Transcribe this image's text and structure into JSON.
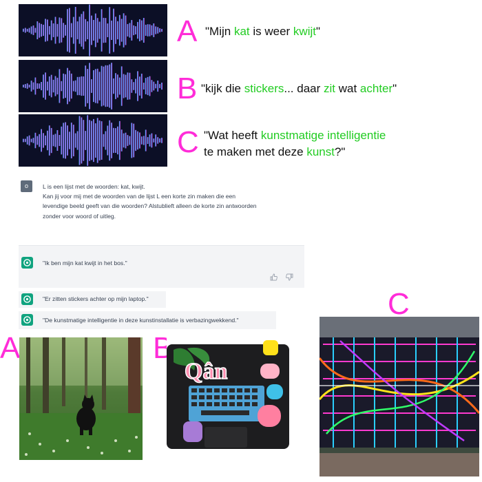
{
  "audio": [
    {
      "letter": "A",
      "parts": [
        "\"Mijn ",
        "kat",
        " is weer ",
        "kwijt",
        "\""
      ]
    },
    {
      "letter": "B",
      "parts": [
        "\"kijk die ",
        "stickers",
        "... daar ",
        "zit",
        " wat ",
        "achter",
        "\""
      ]
    },
    {
      "letter": "C",
      "line1": [
        "\"Wat heeft ",
        "kunstmatige intelligentie"
      ],
      "line2": [
        "te maken met deze ",
        "kunst",
        "?\""
      ]
    }
  ],
  "chat": {
    "user_badge": "o",
    "prompt_lines": [
      "L is een lijst met de woorden: kat, kwijt.",
      "Kan jij voor mij met de woorden van de lijst L een korte zin maken die een",
      "levendige beeld geeft van die woorden? Alstublieft alleen de korte zin antwoorden",
      "zonder voor woord of uitleg."
    ],
    "responses": [
      "\"Ik ben mijn kat kwijt in het bos.\"",
      "\"Er zitten stickers achter op mijn laptop.\"",
      "\"De kunstmatige intelligentie in deze kunstinstallatie is verbazingwekkend.\""
    ],
    "thumb_up": "👍",
    "thumb_down": "👎"
  },
  "images": [
    {
      "letter": "A"
    },
    {
      "letter": "B",
      "sticker_text": "Qân"
    },
    {
      "letter": "C"
    }
  ],
  "colors": {
    "letter": "#ff2cd8",
    "highlight": "#22cc22",
    "wave_bg": "#0c0f26",
    "bot_icon": "#10a37f"
  }
}
